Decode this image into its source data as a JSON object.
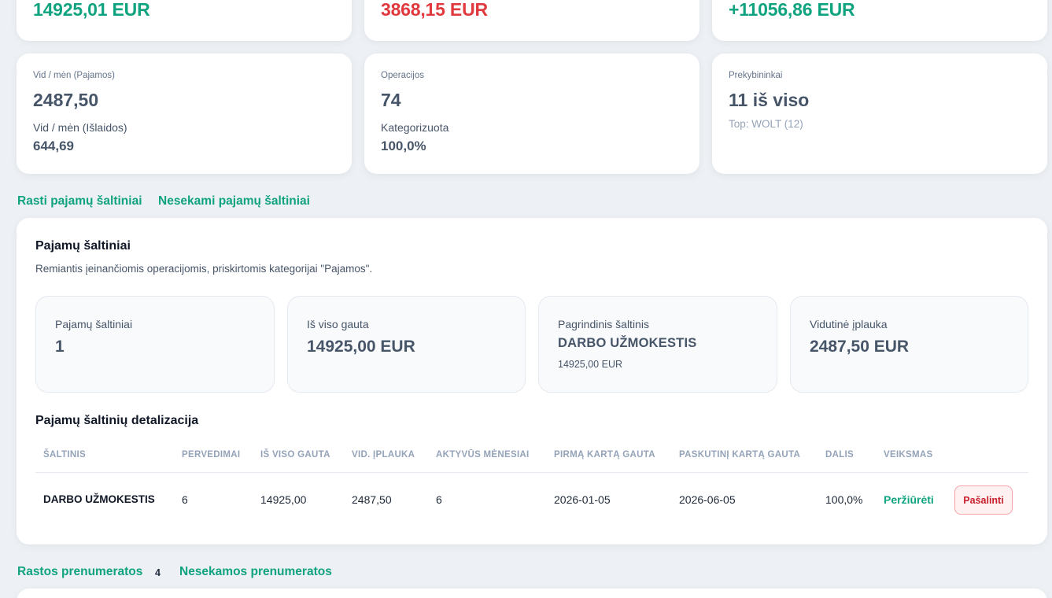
{
  "summary": {
    "income_total": "14925,01 EUR",
    "expenses_total": "3868,15 EUR",
    "net_total": "+11056,86 EUR"
  },
  "stats": {
    "avg_income": {
      "label": "Vid / mėn (Pajamos)",
      "value": "2487,50",
      "sub_label": "Vid / mėn (Išlaidos)",
      "sub_value": "644,69"
    },
    "operations": {
      "label": "Operacijos",
      "value": "74",
      "sub_label": "Kategorizuota",
      "sub_value": "100,0%"
    },
    "merchants": {
      "label": "Prekybininkai",
      "value": "11 iš viso",
      "hint": "Top: WOLT (12)"
    }
  },
  "income_tabs": {
    "found": "Rasti pajamų šaltiniai",
    "untracked": "Nesekami pajamų šaltiniai"
  },
  "income_panel": {
    "title": "Pajamų šaltiniai",
    "description": "Remiantis įeinančiomis operacijomis, priskirtomis kategorijai \"Pajamos\".",
    "cards": {
      "sources": {
        "label": "Pajamų šaltiniai",
        "value": "1"
      },
      "received": {
        "label": "Iš viso gauta",
        "value": "14925,00 EUR"
      },
      "main": {
        "label": "Pagrindinis šaltinis",
        "value": "DARBO UŽMOKESTIS",
        "sub": "14925,00 EUR"
      },
      "average": {
        "label": "Vidutinė įplauka",
        "value": "2487,50 EUR"
      }
    },
    "detail_title": "Pajamų šaltinių detalizacija",
    "columns": {
      "source": "ŠALTINIS",
      "transfers": "PERVEDIMAI",
      "total": "IŠ VISO GAUTA",
      "avg": "VID. ĮPLAUKA",
      "active_months": "AKTYVŪS MĖNESIAI",
      "first": "PIRMĄ KARTĄ GAUTA",
      "last": "PASKUTINĮ KARTĄ GAUTA",
      "share": "DALIS",
      "action": "VEIKSMAS"
    },
    "rows": [
      {
        "source": "DARBO UŽMOKESTIS",
        "transfers": "6",
        "total": "14925,00",
        "avg": "2487,50",
        "active_months": "6",
        "first": "2026-01-05",
        "last": "2026-06-05",
        "share": "100,0%",
        "view": "Peržiūrėti",
        "remove": "Pašalinti"
      }
    ]
  },
  "subscription_tabs": {
    "found": "Rastos prenumeratos",
    "found_count": "4",
    "untracked": "Nesekamos prenumeratos"
  },
  "colors": {
    "accent": "#10a37f",
    "negative": "#e0393e",
    "danger_border": "#f5a3a8"
  }
}
